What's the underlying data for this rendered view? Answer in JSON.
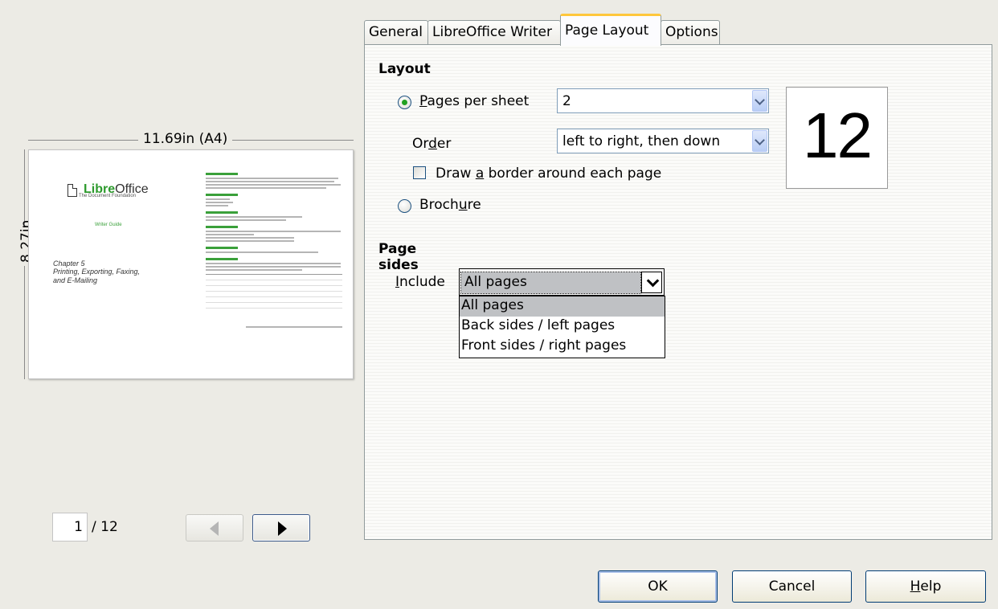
{
  "preview": {
    "width_label": "11.69in (A4)",
    "height_label": "8.27in",
    "page": {
      "brand_libre": "Libre",
      "brand_office": "Office",
      "foundation": "The Document Foundation",
      "guide": "Writer Guide",
      "chapter_line1": "Chapter 5",
      "chapter_line2": "Printing, Exporting, Faxing,",
      "chapter_line3": "and E-Mailing"
    },
    "current_page": "1",
    "total_pages": "/ 12"
  },
  "tabs": [
    "General",
    "LibreOffice Writer",
    "Page Layout",
    "Options"
  ],
  "active_tab": "Page Layout",
  "layout": {
    "heading": "Layout",
    "pages_per_sheet_pre": "",
    "pages_per_sheet_mnemonic": "P",
    "pages_per_sheet_post": "ages per sheet",
    "pages_per_sheet_value": "2",
    "order_pre": "Or",
    "order_mnemonic": "d",
    "order_post": "er",
    "order_value": "left to right, then down",
    "border_pre": "Draw ",
    "border_mnemonic": "a",
    "border_post": " border around each page",
    "brochure_pre": "Broch",
    "brochure_mnemonic": "u",
    "brochure_post": "re",
    "preview_number": "12"
  },
  "page_sides": {
    "heading": "Page sides",
    "include_pre": "",
    "include_mnemonic": "I",
    "include_post": "nclude",
    "include_value": "All pages",
    "options": [
      "All pages",
      "Back sides / left pages",
      "Front sides / right pages"
    ]
  },
  "buttons": {
    "ok": "OK",
    "cancel": "Cancel",
    "help_mnemonic": "H",
    "help_post": "elp"
  }
}
